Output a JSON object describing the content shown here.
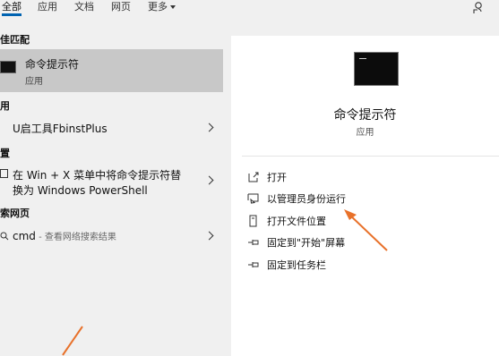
{
  "tabs": [
    {
      "label": "全部",
      "active": true
    },
    {
      "label": "应用",
      "active": false
    },
    {
      "label": "文档",
      "active": false
    },
    {
      "label": "网页",
      "active": false
    },
    {
      "label": "更多",
      "active": false
    }
  ],
  "left": {
    "best_match_heading": "佳匹配",
    "best_match": {
      "title": "命令提示符",
      "subtitle": "应用"
    },
    "apps_heading": "用",
    "app_item": "U启工具FbinstPlus",
    "settings_heading": "置",
    "setting_item_line1": "在 Win + X 菜单中将命令提示符替",
    "setting_item_line2": "换为 Windows PowerShell",
    "web_heading": "索网页",
    "web_item_main": "cmd",
    "web_item_sub": " - 查看网络搜索结果"
  },
  "right": {
    "title": "命令提示符",
    "subtitle": "应用",
    "actions": [
      {
        "label": "打开",
        "icon": "open-icon"
      },
      {
        "label": "以管理员身份运行",
        "icon": "run-as-admin-icon"
      },
      {
        "label": "打开文件位置",
        "icon": "file-location-icon"
      },
      {
        "label": "固定到\"开始\"屏幕",
        "icon": "pin-icon"
      },
      {
        "label": "固定到任务栏",
        "icon": "pin-icon"
      }
    ]
  },
  "colors": {
    "accent": "#0063b1",
    "annotation_arrow": "#e8712a",
    "selected_bg": "#c8c8c8"
  }
}
